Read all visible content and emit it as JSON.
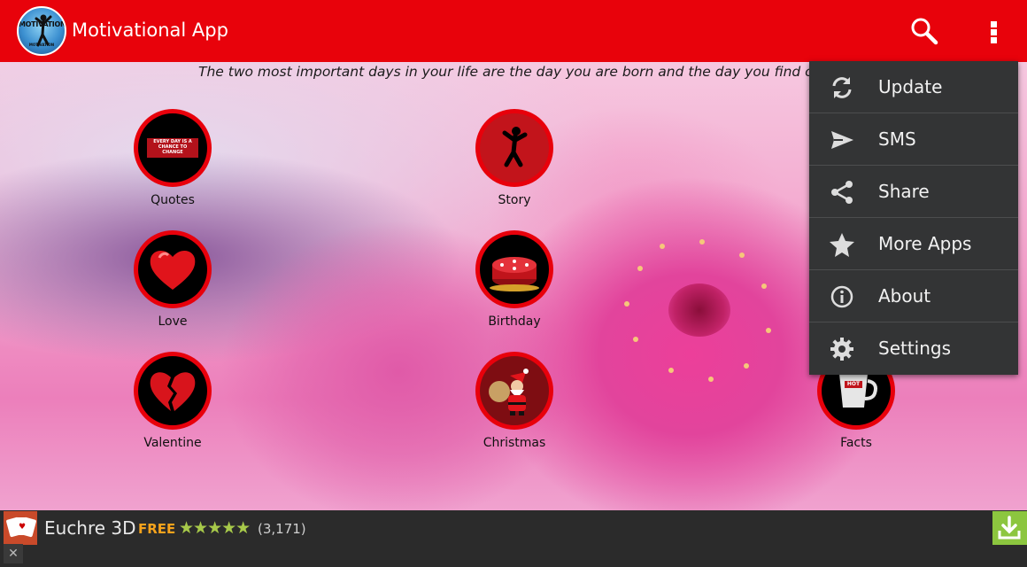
{
  "app_bar": {
    "title": "Motivational App",
    "logo_text": "MOTIVATION",
    "logo_subtext": "MOTIVATION",
    "background_color": "#e8020b",
    "search_icon": "search-icon",
    "overflow_icon": "overflow-menu-icon"
  },
  "quote": "The two most important days in your life are the day you are born and the day you find out w",
  "tiles": [
    {
      "label": "Quotes",
      "icon": "quotes-image",
      "image_text": "EVERY DAY IS A CHANCE TO CHANGE"
    },
    {
      "label": "Story",
      "icon": "dancing-person-icon"
    },
    {
      "label": "Love",
      "icon": "heart-icon"
    },
    {
      "label": "Birthday",
      "icon": "cake-icon"
    },
    {
      "label": "Valentine",
      "icon": "broken-heart-icon"
    },
    {
      "label": "Christmas",
      "icon": "santa-icon"
    },
    {
      "label": "Facts",
      "icon": "hot-cup-icon",
      "image_text": "HOT"
    }
  ],
  "menu": {
    "items": [
      {
        "label": "Update",
        "icon": "refresh-icon"
      },
      {
        "label": "SMS",
        "icon": "send-icon"
      },
      {
        "label": "Share",
        "icon": "share-icon"
      },
      {
        "label": "More Apps",
        "icon": "star-icon"
      },
      {
        "label": "About",
        "icon": "info-icon"
      },
      {
        "label": "Settings",
        "icon": "gear-icon"
      }
    ]
  },
  "ad": {
    "title": "Euchre 3D",
    "price": "FREE",
    "stars": "★★★★★",
    "rating_value": 4.5,
    "rating_count": "(3,171)",
    "close_symbol": "✕",
    "icon": "cards-icon",
    "install_icon": "download-icon"
  },
  "colors": {
    "accent_red": "#e8020b",
    "menu_bg": "#333435",
    "ad_free": "#f7a31c",
    "ad_stars": "#a7c94a",
    "install_green": "#8cc63f"
  }
}
